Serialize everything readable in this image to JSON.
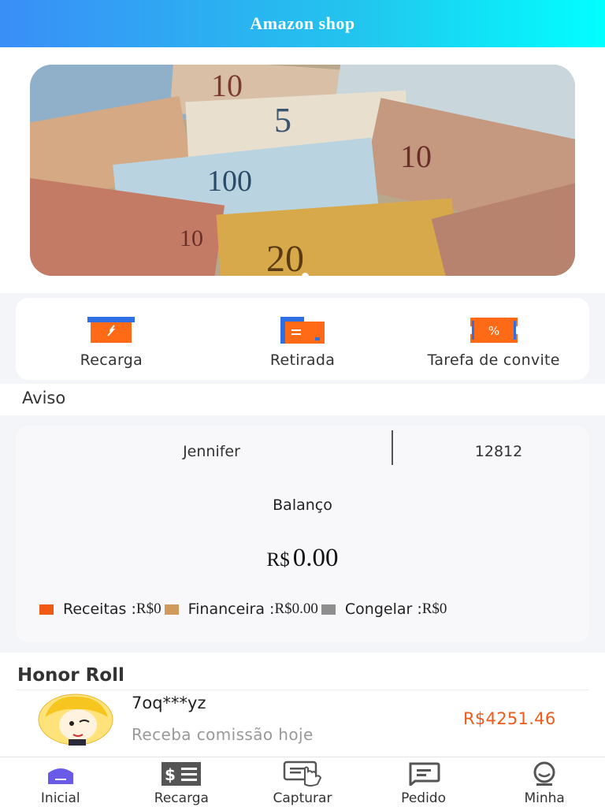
{
  "header": {
    "title": "Amazon shop"
  },
  "quick_actions": [
    {
      "label": "Recarga",
      "icon": "recharge-icon"
    },
    {
      "label": "Retirada",
      "icon": "withdraw-icon"
    },
    {
      "label": "Tarefa de convite",
      "icon": "coupon-icon"
    }
  ],
  "notice": {
    "label": "Aviso"
  },
  "account": {
    "name": "Jennifer",
    "id": "12812",
    "balance_label": "Balanço",
    "currency": "R$",
    "balance": "0.00",
    "stats": [
      {
        "label": "Receitas : ",
        "value": "R$0",
        "color": "#f05a14"
      },
      {
        "label": "Financeira : ",
        "value": "R$0.00",
        "color": "#cf9a5c"
      },
      {
        "label": "Congelar : ",
        "value": "R$0",
        "color": "#8e8e8e"
      }
    ]
  },
  "honor_roll": {
    "title": "Honor Roll",
    "entries": [
      {
        "name": "7oq***yz",
        "desc": "Receba comissão hoje",
        "amount": "R$4251.46"
      }
    ]
  },
  "tabbar": [
    {
      "label": "Inicial",
      "icon": "home-icon",
      "active": true
    },
    {
      "label": "Recarga",
      "icon": "cash-icon"
    },
    {
      "label": "Capturar",
      "icon": "touch-icon"
    },
    {
      "label": "Pedido",
      "icon": "order-icon"
    },
    {
      "label": "Minha",
      "icon": "profile-icon"
    }
  ],
  "colors": {
    "accent": "#f05a14",
    "brand_blue": "#3a8ef7",
    "tab_active": "#6a5ae8"
  }
}
